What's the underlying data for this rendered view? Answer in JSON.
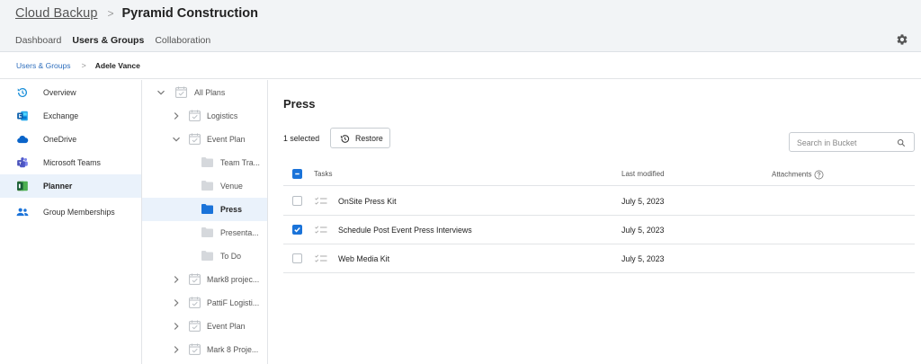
{
  "header": {
    "app_title": "Cloud Backup",
    "separator": ">",
    "org_name": "Pyramid Construction",
    "nav": [
      {
        "label": "Dashboard",
        "active": false
      },
      {
        "label": "Users & Groups",
        "active": true
      },
      {
        "label": "Collaboration",
        "active": false
      }
    ],
    "settings_icon": "gear-icon"
  },
  "breadcrumb": {
    "parent": "Users & Groups",
    "separator": ">",
    "current": "Adele Vance"
  },
  "leftnav": {
    "items": [
      {
        "label": "Overview",
        "icon": "history-clock-icon",
        "active": false
      },
      {
        "label": "Exchange",
        "icon": "exchange-icon",
        "active": false
      },
      {
        "label": "OneDrive",
        "icon": "onedrive-cloud-icon",
        "active": false
      },
      {
        "label": "Microsoft Teams",
        "icon": "teams-icon",
        "active": false
      },
      {
        "label": "Planner",
        "icon": "planner-icon",
        "active": true
      },
      {
        "label": "Group Memberships",
        "icon": "group-people-icon",
        "active": false
      }
    ]
  },
  "tree": {
    "items": [
      {
        "label": "All Plans",
        "level": 0,
        "chevron": "down",
        "kind": "plan",
        "active": false
      },
      {
        "label": "Logistics",
        "level": 1,
        "chevron": "right",
        "kind": "plan",
        "active": false
      },
      {
        "label": "Event Plan",
        "level": 1,
        "chevron": "down",
        "kind": "plan",
        "active": false
      },
      {
        "label": "Team Tra...",
        "level": 2,
        "chevron": "",
        "kind": "folder",
        "active": false
      },
      {
        "label": "Venue",
        "level": 2,
        "chevron": "",
        "kind": "folder",
        "active": false
      },
      {
        "label": "Press",
        "level": 2,
        "chevron": "",
        "kind": "folder",
        "active": true
      },
      {
        "label": "Presenta...",
        "level": 2,
        "chevron": "",
        "kind": "folder",
        "active": false
      },
      {
        "label": "To Do",
        "level": 2,
        "chevron": "",
        "kind": "folder",
        "active": false
      },
      {
        "label": "Mark8 projec...",
        "level": 1,
        "chevron": "right",
        "kind": "plan",
        "active": false
      },
      {
        "label": "PattiF Logisti...",
        "level": 1,
        "chevron": "right",
        "kind": "plan",
        "active": false
      },
      {
        "label": "Event Plan",
        "level": 1,
        "chevron": "right",
        "kind": "plan",
        "active": false
      },
      {
        "label": "Mark 8 Proje...",
        "level": 1,
        "chevron": "right",
        "kind": "plan",
        "active": false
      }
    ]
  },
  "main": {
    "title": "Press",
    "selected_count": "1 selected",
    "restore_label": "Restore",
    "search_placeholder": "Search in Bucket",
    "columns": {
      "tasks": "Tasks",
      "last_modified": "Last modified",
      "attachments": "Attachments"
    },
    "rows": [
      {
        "name": "OnSite Press Kit",
        "modified": "July 5, 2023",
        "checked": false
      },
      {
        "name": "Schedule Post Event Press Interviews",
        "modified": "July 5, 2023",
        "checked": true
      },
      {
        "name": "Web Media Kit",
        "modified": "July 5, 2023",
        "checked": false
      }
    ]
  },
  "colors": {
    "accent": "#1a73d9",
    "link": "#2f6fbd",
    "active_bg": "#eaf2fb",
    "header_bg": "#f2f4f6"
  }
}
